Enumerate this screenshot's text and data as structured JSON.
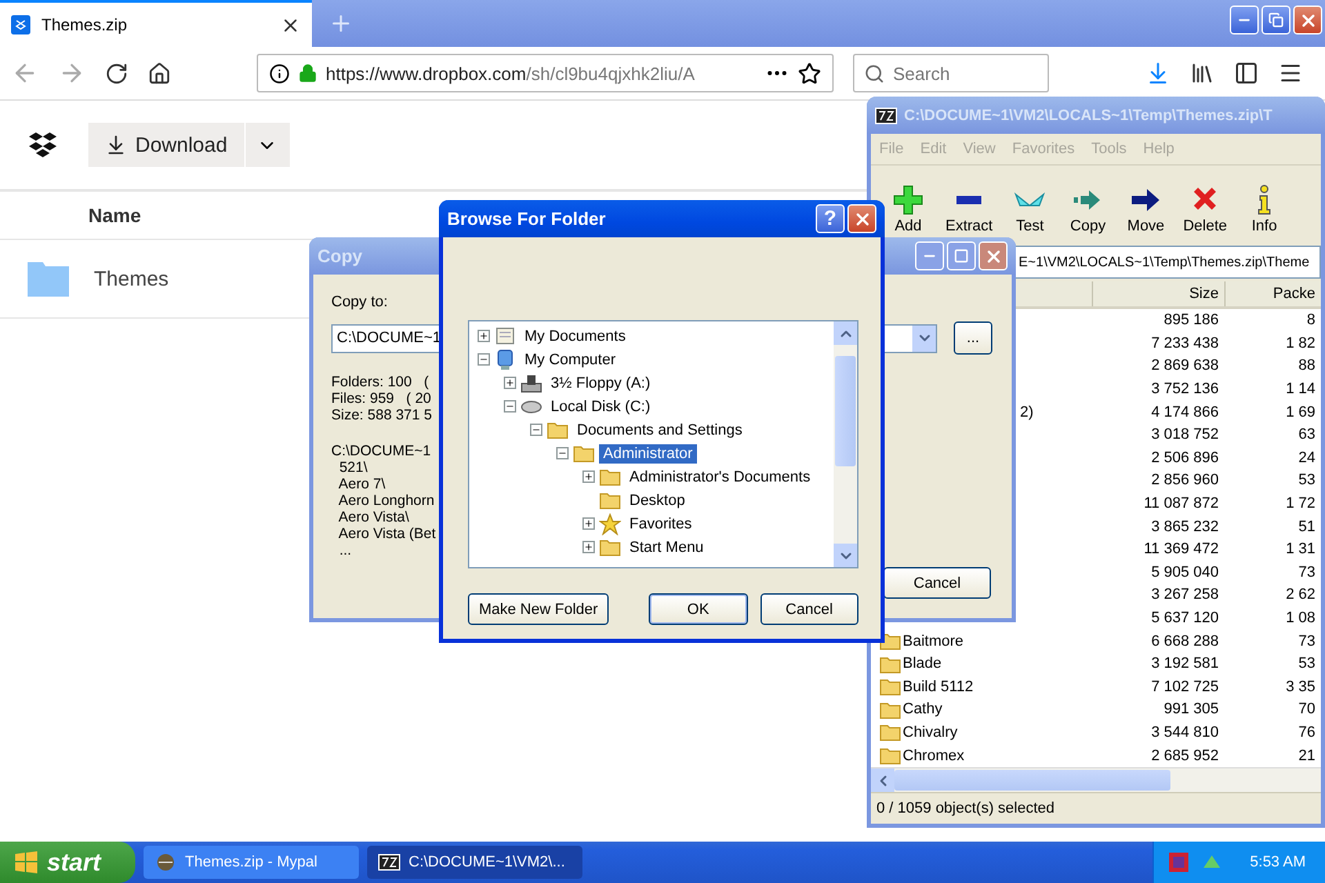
{
  "browser": {
    "tab": {
      "title": "Themes.zip",
      "selected": true
    },
    "address": {
      "host_part": "https://www.dropbox.com",
      "path_part": "/sh/cl9bu4qjxhk2liu/A"
    },
    "search": {
      "placeholder": "Search"
    }
  },
  "dropbox": {
    "download_button": "Download",
    "column": "Name",
    "files": [
      {
        "name": "Themes"
      }
    ]
  },
  "sevenzip": {
    "title": "C:\\DOCUME~1\\VM2\\LOCALS~1\\Temp\\Themes.zip\\T",
    "menu": [
      "File",
      "Edit",
      "View",
      "Favorites",
      "Tools",
      "Help"
    ],
    "toolbar": [
      {
        "label": "Add",
        "kind": "add"
      },
      {
        "label": "Extract",
        "kind": "extract"
      },
      {
        "label": "Test",
        "kind": "test"
      },
      {
        "label": "Copy",
        "kind": "copy"
      },
      {
        "label": "Move",
        "kind": "move"
      },
      {
        "label": "Delete",
        "kind": "delete"
      },
      {
        "label": "Info",
        "kind": "info"
      }
    ],
    "address": "E~1\\VM2\\LOCALS~1\\Temp\\Themes.zip\\Theme",
    "columns": [
      "Size",
      "Packe"
    ],
    "rows": [
      {
        "size": "895 186",
        "packed": "8"
      },
      {
        "size": "7 233 438",
        "packed": "1 82"
      },
      {
        "size": "2 869 638",
        "packed": "88"
      },
      {
        "size": "3 752 136",
        "packed": "1 14"
      },
      {
        "name_tail": "2)",
        "size": "4 174 866",
        "packed": "1 69"
      },
      {
        "size": "3 018 752",
        "packed": "63"
      },
      {
        "size": "2 506 896",
        "packed": "24"
      },
      {
        "size": "2 856 960",
        "packed": "53"
      },
      {
        "size": "11 087 872",
        "packed": "1 72"
      },
      {
        "size": "3 865 232",
        "packed": "51"
      },
      {
        "size": "11 369 472",
        "packed": "1 31"
      },
      {
        "size": "5 905 040",
        "packed": "73"
      },
      {
        "size": "3 267 258",
        "packed": "2 62"
      },
      {
        "size": "5 637 120",
        "packed": "1 08"
      },
      {
        "name": "Baitmore",
        "size": "6 668 288",
        "packed": "73"
      },
      {
        "name": "Blade",
        "size": "3 192 581",
        "packed": "53"
      },
      {
        "name": "Build 5112",
        "size": "7 102 725",
        "packed": "3 35"
      },
      {
        "name": "Cathy",
        "size": "991 305",
        "packed": "70"
      },
      {
        "name": "Chivalry",
        "size": "3 544 810",
        "packed": "76"
      },
      {
        "name": "Chromex",
        "size": "2 685 952",
        "packed": "21"
      }
    ],
    "status": "0 / 1059 object(s) selected"
  },
  "copy_dialog": {
    "title": "Copy",
    "label": "Copy to:",
    "path": "C:\\DOCUME~1",
    "stats": [
      "Folders: 100   (",
      "Files: 959   ( 20",
      "Size: 588 371 5"
    ],
    "list": [
      "C:\\DOCUME~1",
      "  521\\",
      "  Aero 7\\",
      "  Aero Longhorn",
      "  Aero Vista\\",
      "  Aero Vista (Bet",
      "  ..."
    ],
    "browse_button": "...",
    "cancel_button": "Cancel"
  },
  "browse_dialog": {
    "title": "Browse For Folder",
    "help": "?",
    "tree": [
      {
        "label": "My Documents",
        "kind": "documents",
        "expanded": false,
        "selected": false
      },
      {
        "label": "My Computer",
        "kind": "computer",
        "expanded": true,
        "selected": false,
        "children": [
          {
            "label": "3½ Floppy (A:)",
            "kind": "floppy",
            "expanded": false,
            "selected": false
          },
          {
            "label": "Local Disk (C:)",
            "kind": "disk",
            "expanded": true,
            "selected": false,
            "children": [
              {
                "label": "Documents and Settings",
                "kind": "folder",
                "expanded": true,
                "selected": false,
                "children": [
                  {
                    "label": "Administrator",
                    "kind": "folder",
                    "expanded": true,
                    "selected": true,
                    "children": [
                      {
                        "label": "Administrator's Documents",
                        "kind": "folder",
                        "expanded": false,
                        "selected": false
                      },
                      {
                        "label": "Desktop",
                        "kind": "folder",
                        "selected": false
                      },
                      {
                        "label": "Favorites",
                        "kind": "star",
                        "expanded": false,
                        "selected": false
                      },
                      {
                        "label": "Start Menu",
                        "kind": "folder",
                        "expanded": false,
                        "selected": false
                      }
                    ]
                  }
                ]
              }
            ]
          }
        ]
      }
    ],
    "buttons": {
      "new_folder": "Make New Folder",
      "ok": "OK",
      "cancel": "Cancel"
    }
  },
  "taskbar": {
    "start": "start",
    "tasks": [
      {
        "label": "Themes.zip - Mypal",
        "kind": "browser",
        "selected": false
      },
      {
        "label": "C:\\DOCUME~1\\VM2\\...",
        "kind": "archive",
        "selected": true
      }
    ],
    "clock": "5:53 AM"
  }
}
